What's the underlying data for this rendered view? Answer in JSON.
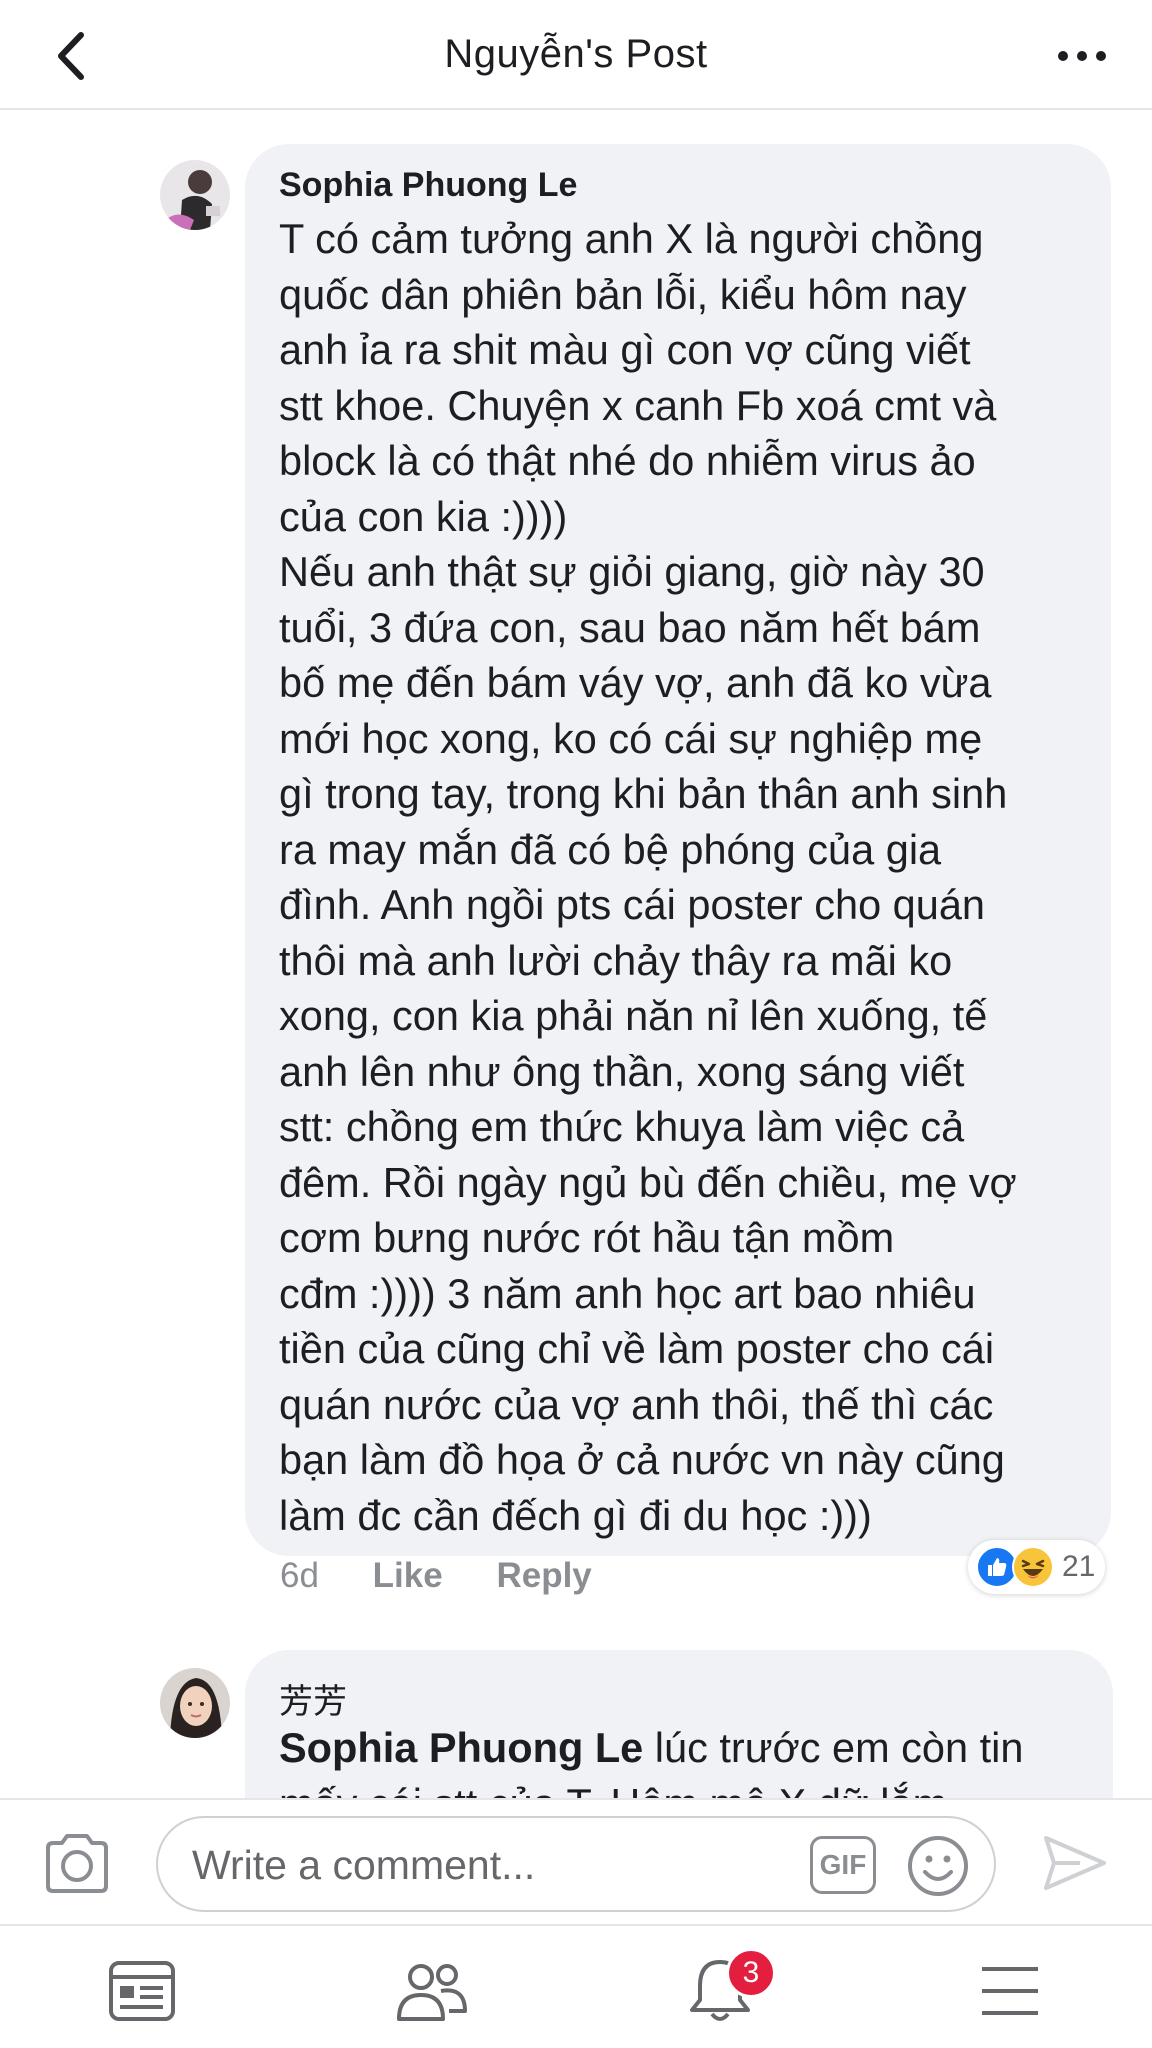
{
  "header": {
    "title": "Nguyễn's Post",
    "back_icon": "chevron-left-icon",
    "more_icon": "more-horizontal-icon"
  },
  "comments": [
    {
      "author": "Sophia Phuong Le",
      "text": "T có cảm tưởng anh X là người chồng\nquốc dân phiên bản lỗi, kiểu hôm nay\nanh ỉa ra shit màu gì con vợ cũng viết\nstt khoe. Chuyện x canh Fb xoá cmt và\nblock là có thật nhé do nhiễm virus ảo\ncủa con kia :))))\nNếu anh thật sự giỏi giang, giờ này 30\ntuổi, 3 đứa con, sau bao năm hết bám\nbố mẹ đến bám váy vợ, anh đã ko vừa\nmới học xong, ko có cái sự nghiệp mẹ\ngì trong tay, trong khi bản thân anh sinh\nra may mắn đã có bệ phóng của gia\nđình. Anh ngồi pts cái poster cho quán\nthôi mà anh lười chảy thây ra mãi ko\nxong, con kia phải năn nỉ lên xuống, tế\nanh lên như ông thần, xong sáng viết\nstt: chồng em thức khuya làm việc cả\nđêm. Rồi ngày ngủ bù đến chiều, mẹ vợ\ncơm bưng nước rót hầu tận mồm\ncđm :)))) 3 năm anh học art bao nhiêu\ntiền của cũng chỉ về làm poster cho cái\nquán nước của vợ anh thôi, thế thì các\nbạn làm đồ họa ở cả nước vn này cũng\nlàm đc cần đếch gì đi du học :)))",
      "time": "6d",
      "like_label": "Like",
      "reply_label": "Reply",
      "reaction_count": "21",
      "reactions": [
        "like-icon",
        "haha-icon"
      ]
    },
    {
      "author": "芳芳",
      "mention": "Sophia Phuong Le",
      "text": " lúc trước em còn tin",
      "text_line2": "mấy cái stt của T. Hôm mê X dữ lắm"
    }
  ],
  "composer": {
    "placeholder": "Write a comment...",
    "gif_label": "GIF",
    "camera_icon": "camera-icon",
    "emoji_icon": "emoji-icon",
    "send_icon": "send-icon"
  },
  "bottom_nav": {
    "items": [
      "news-feed-icon",
      "friends-icon",
      "notifications-icon",
      "menu-icon"
    ],
    "notification_badge": "3"
  },
  "colors": {
    "bubble": "#f0f2f5",
    "like_blue": "#1877f2",
    "badge_red": "#e41e3f",
    "meta_gray": "#8a8d91"
  }
}
